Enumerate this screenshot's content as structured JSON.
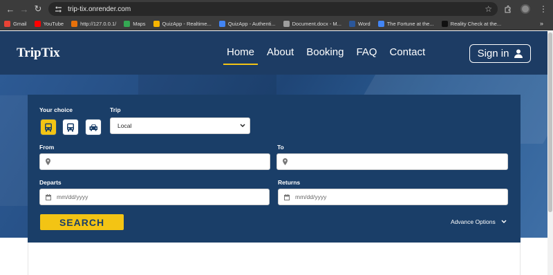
{
  "browser": {
    "url": "trip-tix.onrender.com",
    "bookmarks": [
      {
        "label": "Gmail",
        "color": "#ea4335"
      },
      {
        "label": "YouTube",
        "color": "#ff0000"
      },
      {
        "label": "http://127.0.0.1/",
        "color": "#e8710a"
      },
      {
        "label": "Maps",
        "color": "#34a853"
      },
      {
        "label": "QuizApp - Realtime...",
        "color": "#f6b400"
      },
      {
        "label": "QuizApp - Authenti...",
        "color": "#4285f4"
      },
      {
        "label": "Document.docx - M...",
        "color": "#9e9e9e"
      },
      {
        "label": "Word",
        "color": "#2b579a"
      },
      {
        "label": "The Fortune at the...",
        "color": "#4285f4"
      },
      {
        "label": "Reality Check at the...",
        "color": "#111111"
      }
    ]
  },
  "header": {
    "brand": "TripTix",
    "nav": [
      {
        "label": "Home",
        "active": true
      },
      {
        "label": "Booking",
        "active": false
      },
      {
        "label": "About",
        "active": false
      },
      {
        "label": "FAQ",
        "active": false
      },
      {
        "label": "Contact",
        "active": false
      }
    ],
    "signin_label": "Sign in"
  },
  "form": {
    "choice_label": "Your choice",
    "trip_label": "Trip",
    "trip_value": "Local",
    "from_label": "From",
    "to_label": "To",
    "departs_label": "Departs",
    "returns_label": "Returns",
    "date_placeholder": "mm/dd/yyyy",
    "search_label": "SEARCH",
    "advance_label": "Advance Options"
  },
  "colors": {
    "header_bg": "#1d3c64",
    "panel_bg": "#1a3e68",
    "accent_yellow": "#f3c414"
  }
}
